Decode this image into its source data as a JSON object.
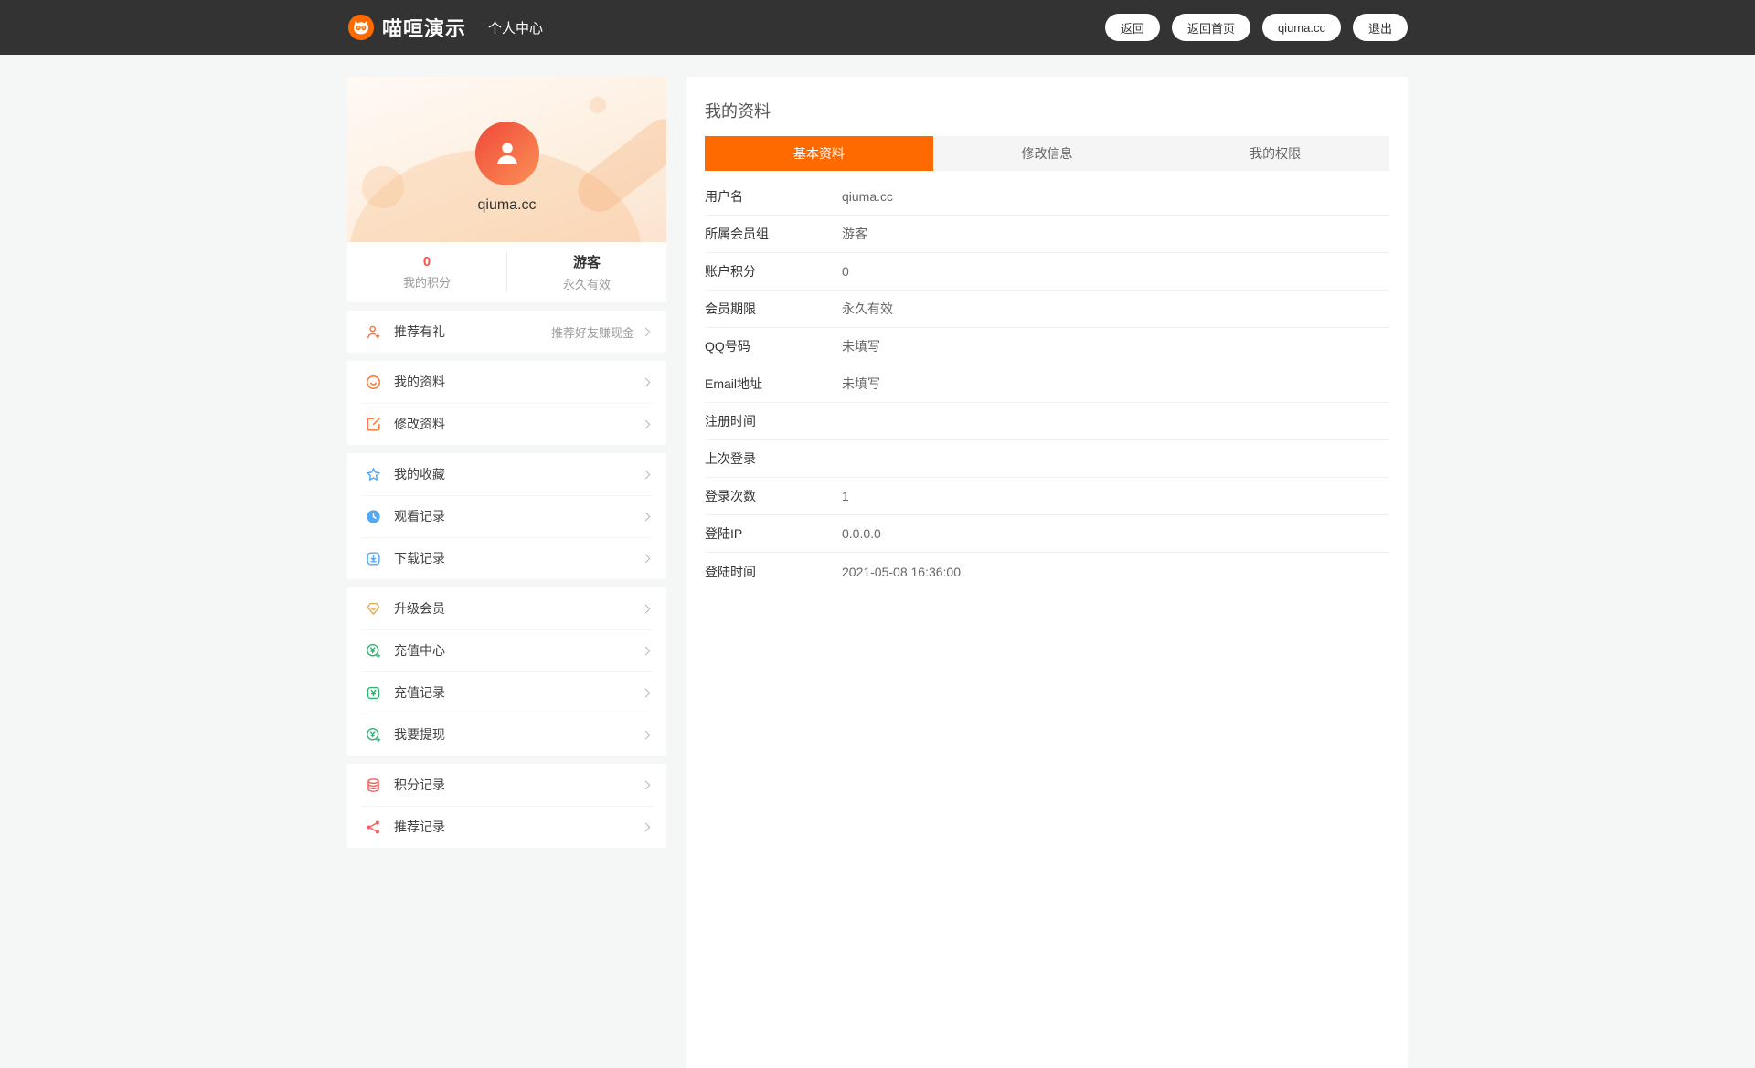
{
  "navbar": {
    "brand": "喵咺演示",
    "nav_link": "个人中心",
    "buttons": {
      "back": "返回",
      "back_home": "返回首页",
      "username": "qiuma.cc",
      "logout": "退出"
    }
  },
  "sidebar": {
    "profile": {
      "username": "qiuma.cc",
      "stats": [
        {
          "value": "0",
          "label": "我的积分"
        },
        {
          "value": "游客",
          "label": "永久有效"
        }
      ]
    },
    "menu_groups": [
      {
        "items": [
          {
            "icon": "person-add-icon",
            "label": "推荐有礼",
            "extra": "推荐好友赚现金"
          }
        ]
      },
      {
        "items": [
          {
            "icon": "smiley-icon",
            "label": "我的资料"
          },
          {
            "icon": "edit-icon",
            "label": "修改资料"
          }
        ]
      },
      {
        "items": [
          {
            "icon": "star-icon",
            "label": "我的收藏"
          },
          {
            "icon": "clock-icon",
            "label": "观看记录"
          },
          {
            "icon": "download-icon",
            "label": "下载记录"
          }
        ]
      },
      {
        "items": [
          {
            "icon": "gem-icon",
            "label": "升级会员"
          },
          {
            "icon": "yen-circle-plus-icon",
            "label": "充值中心"
          },
          {
            "icon": "yen-square-icon",
            "label": "充值记录"
          },
          {
            "icon": "yen-withdraw-icon",
            "label": "我要提现"
          }
        ]
      },
      {
        "items": [
          {
            "icon": "database-icon",
            "label": "积分记录"
          },
          {
            "icon": "share-icon",
            "label": "推荐记录"
          }
        ]
      }
    ]
  },
  "main": {
    "title": "我的资料",
    "tabs": [
      {
        "label": "基本资料",
        "active": true
      },
      {
        "label": "修改信息",
        "active": false
      },
      {
        "label": "我的权限",
        "active": false
      }
    ],
    "rows": [
      {
        "label": "用户名",
        "value": "qiuma.cc"
      },
      {
        "label": "所属会员组",
        "value": "游客"
      },
      {
        "label": "账户积分",
        "value": "0"
      },
      {
        "label": "会员期限",
        "value": "永久有效"
      },
      {
        "label": "QQ号码",
        "value": "未填写"
      },
      {
        "label": "Email地址",
        "value": "未填写"
      },
      {
        "label": "注册时间",
        "value": ""
      },
      {
        "label": "上次登录",
        "value": ""
      },
      {
        "label": "登录次数",
        "value": "1"
      },
      {
        "label": "登陆IP",
        "value": "0.0.0.0"
      },
      {
        "label": "登陆时间",
        "value": "2021-05-08 16:36:00"
      }
    ]
  },
  "colors": {
    "accent_orange": "#ff6a00",
    "navbar_bg": "#333333",
    "page_bg": "#f5f6f6",
    "stat_value_red": "#ff4d4f",
    "icon_orange": "#ff7033",
    "icon_blue": "#54a8f5",
    "icon_gold": "#dfae62",
    "icon_green": "#2fb573",
    "icon_red": "#f85f5f",
    "avatar_gradient_start": "#f0503c",
    "avatar_gradient_end": "#fb8d55"
  }
}
